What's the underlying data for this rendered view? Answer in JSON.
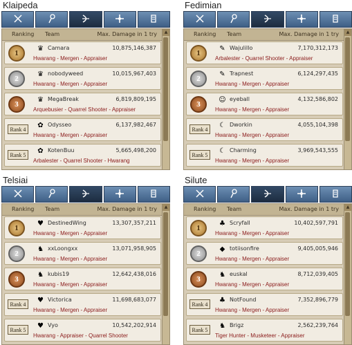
{
  "headers": {
    "ranking": "Ranking",
    "team": "Team",
    "damage": "Max. Damage in 1 try"
  },
  "colors": {
    "class_text": "#8a1a1a",
    "tab_bg": "#4f6f95",
    "panel_bg": "#d7ccb6"
  },
  "tab_icons": [
    "swords-icon",
    "staff-icon",
    "bow-icon",
    "cross-icon",
    "scroll-icon"
  ],
  "boards": [
    {
      "region": "Klaipeda",
      "rows": [
        {
          "rank": "1",
          "medal": "gold",
          "avatar": "♛",
          "name": "Camara",
          "damage": "10,875,146,387",
          "classes": "Hwarang - Mergen - Appraiser"
        },
        {
          "rank": "2",
          "medal": "silver",
          "avatar": "♛",
          "name": "nobodyweed",
          "damage": "10,015,967,403",
          "classes": "Hwarang - Mergen - Appraiser"
        },
        {
          "rank": "3",
          "medal": "bronze",
          "avatar": "♛",
          "name": "MegaBreak",
          "damage": "6,819,809,195",
          "classes": "Arquebusier - Quarrel Shooter - Appraiser"
        },
        {
          "rank": "Rank 4",
          "medal": "box",
          "avatar": "✿",
          "name": "Odysseo",
          "damage": "6,137,982,467",
          "classes": "Hwarang - Mergen - Appraiser"
        },
        {
          "rank": "Rank 5",
          "medal": "box",
          "avatar": "✿",
          "name": "KotenBuu",
          "damage": "5,665,498,200",
          "classes": "Arbalester - Quarrel Shooter - Hwarang"
        }
      ]
    },
    {
      "region": "Fedimian",
      "rows": [
        {
          "rank": "1",
          "medal": "gold",
          "avatar": "✎",
          "name": "Wajulillo",
          "damage": "7,170,312,173",
          "classes": "Arbalester - Quarrel Shooter - Appraiser"
        },
        {
          "rank": "2",
          "medal": "silver",
          "avatar": "✎",
          "name": "Trapnest",
          "damage": "6,124,297,435",
          "classes": "Hwarang - Mergen - Appraiser"
        },
        {
          "rank": "3",
          "medal": "bronze",
          "avatar": "☺",
          "name": "eyeball",
          "damage": "4,132,586,802",
          "classes": "Hwarang - Mergen - Appraiser"
        },
        {
          "rank": "Rank 4",
          "medal": "box",
          "avatar": "☾",
          "name": "Dworkin",
          "damage": "4,055,104,398",
          "classes": "Hwarang - Mergen - Appraiser"
        },
        {
          "rank": "Rank 5",
          "medal": "box",
          "avatar": "☾",
          "name": "Charming",
          "damage": "3,969,543,555",
          "classes": "Hwarang - Mergen - Appraiser"
        }
      ]
    },
    {
      "region": "Telsiai",
      "rows": [
        {
          "rank": "1",
          "medal": "gold",
          "avatar": "♥",
          "name": "DestinedWing",
          "damage": "13,307,357,211",
          "classes": "Hwarang - Mergen - Appraiser"
        },
        {
          "rank": "2",
          "medal": "silver",
          "avatar": "♞",
          "name": "xxLoongxx",
          "damage": "13,071,958,905",
          "classes": "Hwarang - Mergen - Appraiser"
        },
        {
          "rank": "3",
          "medal": "bronze",
          "avatar": "♞",
          "name": "kubis19",
          "damage": "12,642,438,016",
          "classes": "Hwarang - Mergen - Appraiser"
        },
        {
          "rank": "Rank 4",
          "medal": "box",
          "avatar": "♥",
          "name": "Victorica",
          "damage": "11,698,683,077",
          "classes": "Hwarang - Mergen - Appraiser"
        },
        {
          "rank": "Rank 5",
          "medal": "box",
          "avatar": "♥",
          "name": "Vyo",
          "damage": "10,542,202,914",
          "classes": "Hwarang - Appraiser - Quarrel Shooter"
        }
      ]
    },
    {
      "region": "Silute",
      "rows": [
        {
          "rank": "1",
          "medal": "gold",
          "avatar": "♣",
          "name": "Scryfall",
          "damage": "10,402,597,791",
          "classes": "Hwarang - Mergen - Appraiser"
        },
        {
          "rank": "2",
          "medal": "silver",
          "avatar": "◆",
          "name": "totiisonfire",
          "damage": "9,405,005,946",
          "classes": "Hwarang - Mergen - Appraiser"
        },
        {
          "rank": "3",
          "medal": "bronze",
          "avatar": "♞",
          "name": "euskal",
          "damage": "8,712,039,405",
          "classes": "Hwarang - Mergen - Appraiser"
        },
        {
          "rank": "Rank 4",
          "medal": "box",
          "avatar": "♣",
          "name": "NotFound",
          "damage": "7,352,896,779",
          "classes": "Hwarang - Mergen - Appraiser"
        },
        {
          "rank": "Rank 5",
          "medal": "box",
          "avatar": "♞",
          "name": "Brigz",
          "damage": "2,562,239,764",
          "classes": "Tiger Hunter - Musketeer - Appraiser"
        }
      ]
    }
  ]
}
